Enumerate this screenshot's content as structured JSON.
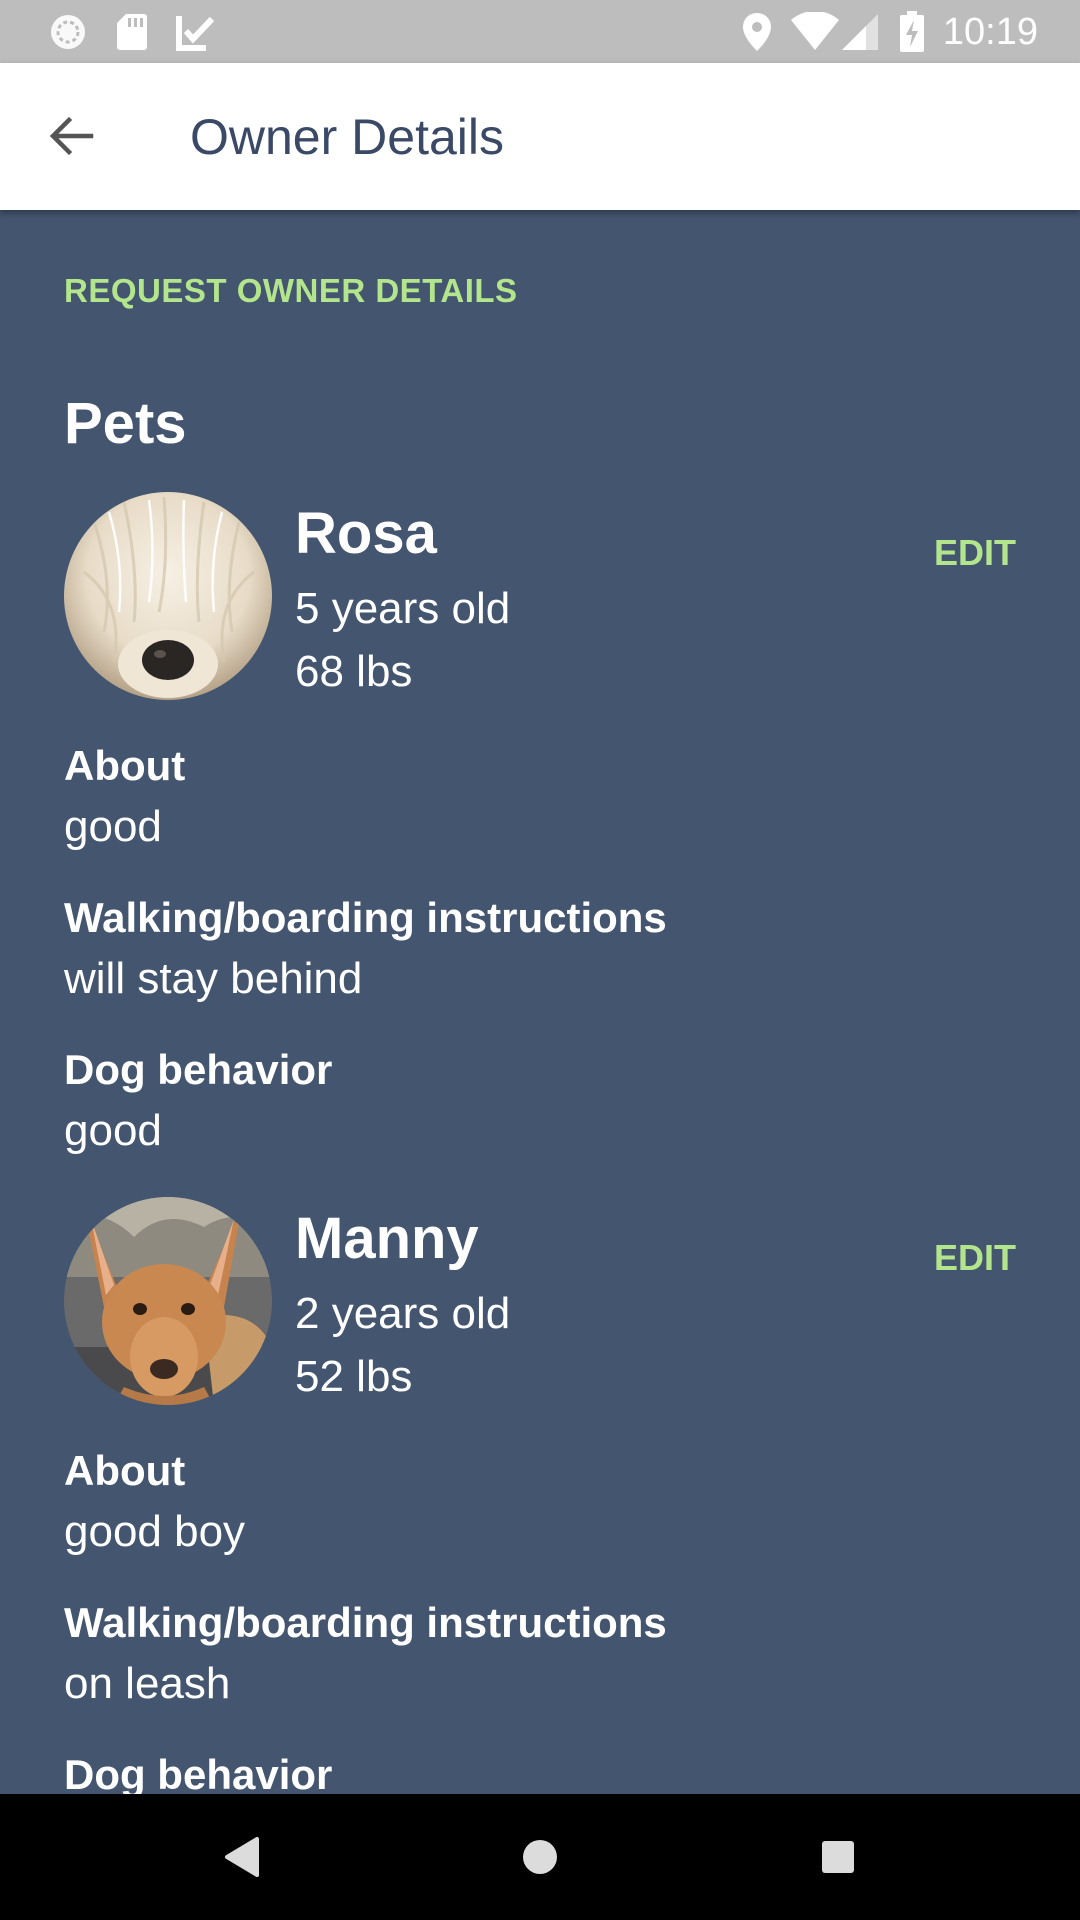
{
  "status_bar": {
    "time": "10:19",
    "icons": [
      "sync-icon",
      "sd-card-icon",
      "task-check-icon",
      "location-icon",
      "wifi-icon",
      "signal-icon",
      "battery-charging-icon"
    ]
  },
  "app_bar": {
    "title": "Owner Details",
    "back_icon": "arrow-back-icon"
  },
  "content": {
    "request_link": "REQUEST OWNER DETAILS",
    "section_title": "Pets",
    "pets": [
      {
        "name": "Rosa",
        "age": "5 years old",
        "weight": "68 lbs",
        "edit_label": "EDIT",
        "fields": [
          {
            "label": "About",
            "value": "good"
          },
          {
            "label": "Walking/boarding instructions",
            "value": "will stay behind"
          },
          {
            "label": "Dog behavior",
            "value": "good"
          }
        ]
      },
      {
        "name": "Manny",
        "age": "2 years old",
        "weight": "52 lbs",
        "edit_label": "EDIT",
        "fields": [
          {
            "label": "About",
            "value": "good boy"
          },
          {
            "label": "Walking/boarding instructions",
            "value": "on leash"
          },
          {
            "label": "Dog behavior",
            "value": ""
          }
        ]
      }
    ]
  },
  "nav_bar": {
    "icons": [
      "back-triangle-icon",
      "home-circle-icon",
      "recents-square-icon"
    ]
  },
  "colors": {
    "background": "#44556f",
    "accent": "#b3e58c",
    "app_bar": "#ffffff",
    "title": "#3a4a66"
  }
}
